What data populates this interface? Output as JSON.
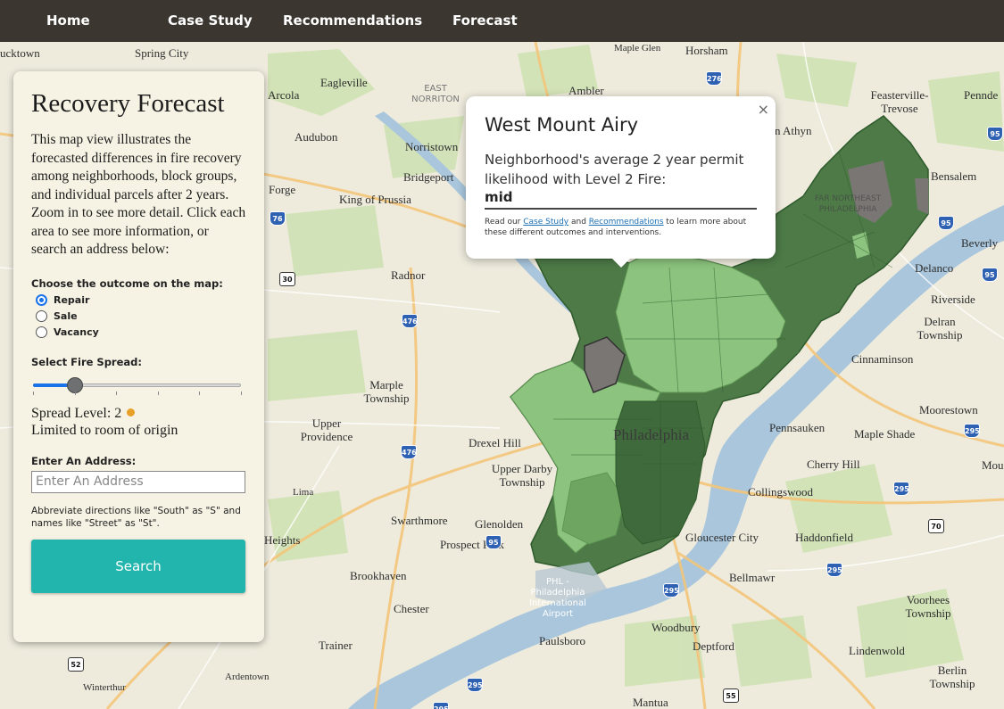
{
  "nav": {
    "home": "Home",
    "case_study": "Case Study",
    "recommendations": "Recommendations",
    "forecast": "Forecast"
  },
  "panel": {
    "title": "Recovery Forecast",
    "description": "This map view illustrates the forecasted differences in fire recovery among neighborhoods, block groups, and individual parcels after 2 years. Zoom in to see more detail. Click each area to see more information, or search an address below:",
    "outcome_label": "Choose the outcome on the map:",
    "outcomes": [
      "Repair",
      "Sale",
      "Vacancy"
    ],
    "selected_outcome": "Repair",
    "spread_label": "Select Fire Spread:",
    "spread_level_text": "Spread Level: 2",
    "spread_value": 2,
    "spread_min": 1,
    "spread_max": 6,
    "spread_dot_color": "#e8a128",
    "spread_description": "Limited to room of origin",
    "address_label": "Enter An Address:",
    "address_placeholder": "Enter An Address",
    "hint": "Abbreviate directions like \"South\" as \"S\" and names like \"Street\" as \"St\".",
    "search_label": "Search"
  },
  "popup": {
    "title": "West Mount Airy",
    "body": "Neighborhood's average 2 year permit likelihood with Level 2 Fire:",
    "value": "mid",
    "foot_pre": "Read our ",
    "foot_link1": "Case Study",
    "foot_mid": " and ",
    "foot_link2": "Recommendations",
    "foot_post": " to learn more about these different outcomes and interventions.",
    "close": "×"
  },
  "map": {
    "places": [
      {
        "name": "Spring City",
        "big": false
      },
      {
        "name": "Eagleville",
        "big": false
      },
      {
        "name": "Arcola",
        "big": false
      },
      {
        "name": "Audubon",
        "big": false
      },
      {
        "name": "EAST NORRITON",
        "big": false
      },
      {
        "name": "Norristown",
        "big": false
      },
      {
        "name": "Bridgeport",
        "big": false
      },
      {
        "name": "Forge",
        "big": false
      },
      {
        "name": "King of Prussia",
        "big": false
      },
      {
        "name": "Radnor",
        "big": false
      },
      {
        "name": "Ambler",
        "big": false
      },
      {
        "name": "Maple Glen",
        "big": false
      },
      {
        "name": "Horsham",
        "big": false
      },
      {
        "name": "Feasterville-Trevose",
        "big": false
      },
      {
        "name": "Pennde",
        "big": false
      },
      {
        "name": "n Athyn",
        "big": false
      },
      {
        "name": "Bensalem",
        "big": false
      },
      {
        "name": "Beverly",
        "big": false
      },
      {
        "name": "Delanco",
        "big": false
      },
      {
        "name": "Riverside",
        "big": false
      },
      {
        "name": "Delran Township",
        "big": false
      },
      {
        "name": "Cinnaminson",
        "big": false
      },
      {
        "name": "Moorestown",
        "big": false
      },
      {
        "name": "Pennsauken",
        "big": false
      },
      {
        "name": "Maple Shade",
        "big": false
      },
      {
        "name": "Mou",
        "big": false
      },
      {
        "name": "Cherry Hill",
        "big": false
      },
      {
        "name": "Collingswood",
        "big": false
      },
      {
        "name": "Haddonfield",
        "big": false
      },
      {
        "name": "Gloucester City",
        "big": false
      },
      {
        "name": "Bellmawr",
        "big": false
      },
      {
        "name": "Voorhees Township",
        "big": false
      },
      {
        "name": "Woodbury",
        "big": false
      },
      {
        "name": "Deptford",
        "big": false
      },
      {
        "name": "Lindenwold",
        "big": false
      },
      {
        "name": "Berlin Township",
        "big": false
      },
      {
        "name": "Mantua",
        "big": false
      },
      {
        "name": "Paulsboro",
        "big": false
      },
      {
        "name": "Chester",
        "big": false
      },
      {
        "name": "Trainer",
        "big": false
      },
      {
        "name": "Ardentown",
        "big": false
      },
      {
        "name": "Winterthur",
        "big": false
      },
      {
        "name": "Brookhaven",
        "big": false
      },
      {
        "name": "Prospect Park",
        "big": false
      },
      {
        "name": "Glenolden",
        "big": false
      },
      {
        "name": "Swarthmore",
        "big": false
      },
      {
        "name": "Lima",
        "big": false
      },
      {
        "name": "Heights",
        "big": false
      },
      {
        "name": "Upper Darby Township",
        "big": false
      },
      {
        "name": "Drexel Hill",
        "big": false
      },
      {
        "name": "Upper Providence",
        "big": false
      },
      {
        "name": "Marple Township",
        "big": false
      },
      {
        "name": "Philadelphia",
        "big": true
      },
      {
        "name": "FAR NORTHEAST PHILADELPHIA",
        "big": false
      },
      {
        "name": "PHL - Philadelphia International Airport",
        "big": false
      },
      {
        "name": "ucktown",
        "big": false
      }
    ],
    "shields": [
      "276",
      "76",
      "30",
      "476",
      "95",
      "476",
      "95",
      "295",
      "295",
      "295",
      "295",
      "295",
      "95",
      "70",
      "52",
      "55",
      "295",
      "95"
    ],
    "colors": {
      "land": "#eeebdd",
      "water": "#a9c6dc",
      "park": "#cfe2b4",
      "dark_green": "#4d7a47",
      "light_green": "#8cc37e",
      "gray": "#7a7673"
    }
  }
}
